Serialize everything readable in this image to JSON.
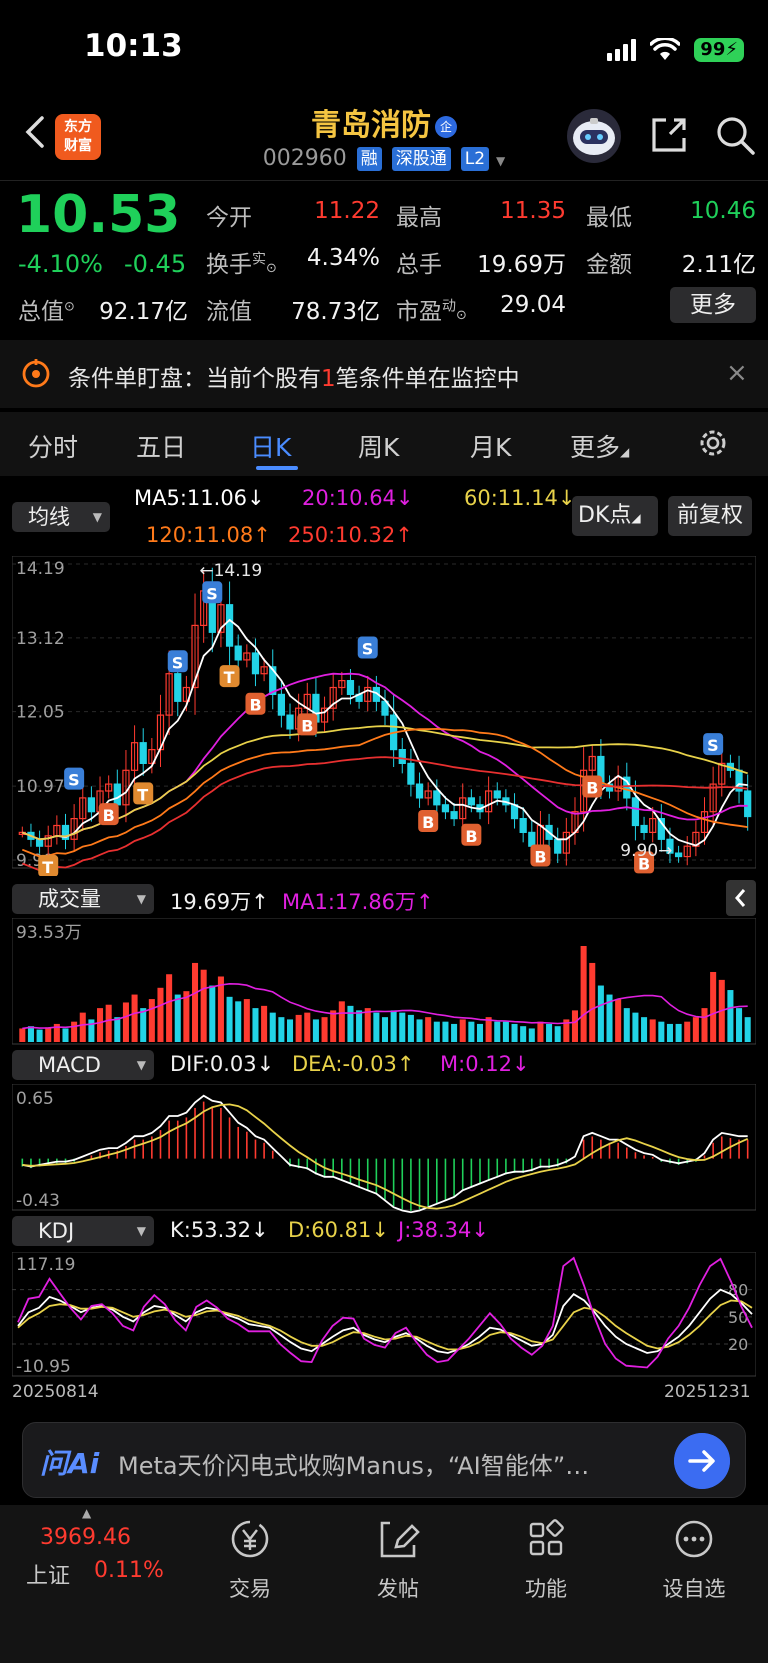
{
  "status_bar": {
    "time": "10:13",
    "battery": "99"
  },
  "header": {
    "logo_line1": "东方",
    "logo_line2": "财富",
    "stock_name": "青岛消防",
    "stock_name_badge": "企",
    "code": "002960",
    "tags": [
      "融",
      "深股通",
      "L2"
    ]
  },
  "quote": {
    "price": "10.53",
    "change_pct": "-4.10%",
    "change_abs": "-0.45",
    "fields": [
      {
        "label": "今开",
        "value": "11.22",
        "color": "#ff3b30"
      },
      {
        "label": "最高",
        "value": "11.35",
        "color": "#ff3b30"
      },
      {
        "label": "最低",
        "value": "10.46",
        "color": "#1fd05a"
      },
      {
        "label": "换手",
        "label_sup": "实",
        "value": "4.34%",
        "color": "#f2f2f2"
      },
      {
        "label": "总手",
        "value": "19.69万",
        "color": "#f2f2f2"
      },
      {
        "label": "金额",
        "value": "2.11亿",
        "color": "#f2f2f2"
      },
      {
        "label": "总值",
        "value": "92.17亿",
        "color": "#f2f2f2"
      },
      {
        "label": "流值",
        "value": "78.73亿",
        "color": "#f2f2f2"
      },
      {
        "label": "市盈",
        "label_sup": "动",
        "value": "29.04",
        "color": "#f2f2f2"
      }
    ],
    "more_label": "更多"
  },
  "notice": {
    "prefix": "条件单盯盘：当前个股有",
    "count": "1",
    "suffix": "笔条件单在监控中",
    "close": "×"
  },
  "tabs": [
    "分时",
    "五日",
    "日K",
    "周K",
    "月K",
    "更多"
  ],
  "active_tab": "日K",
  "indicators": {
    "ma_selector": "均线",
    "ma5": "MA5:11.06↓",
    "ma20": "20:10.64↓",
    "ma60": "60:11.14↓",
    "ma120": "120:11.08↑",
    "ma250": "250:10.32↑",
    "dk_button": "DK点",
    "adjust_button": "前复权",
    "colors": {
      "ma5": "#ffffff",
      "ma20": "#e020e0",
      "ma60": "#e8d24a",
      "ma120": "#ff7a1a",
      "ma250": "#e83030"
    }
  },
  "chart_data": [
    {
      "type": "candlestick",
      "title": "日K",
      "ylim": [
        9.9,
        14.19
      ],
      "y_ticks": [
        "14.19",
        "13.12",
        "12.05",
        "10.97",
        "9.90"
      ],
      "high_label": "←14.19",
      "low_label": "9.90→",
      "signal_labels": [
        "S",
        "B",
        "T"
      ],
      "close_series": [
        10.3,
        10.2,
        10.1,
        10.25,
        10.4,
        10.2,
        10.5,
        10.8,
        10.6,
        10.9,
        11.0,
        10.7,
        11.2,
        11.6,
        11.3,
        11.5,
        12.0,
        12.6,
        12.2,
        12.4,
        13.3,
        13.8,
        13.2,
        13.6,
        13.0,
        12.8,
        12.9,
        12.6,
        12.7,
        12.3,
        12.0,
        11.8,
        12.1,
        12.3,
        11.9,
        12.1,
        12.4,
        12.5,
        12.3,
        12.2,
        12.4,
        12.2,
        12.0,
        11.5,
        11.3,
        11.0,
        10.8,
        10.9,
        10.7,
        10.6,
        10.5,
        10.8,
        10.7,
        10.6,
        10.9,
        10.8,
        10.7,
        10.5,
        10.3,
        10.1,
        10.4,
        10.2,
        10.0,
        10.3,
        10.6,
        11.2,
        11.4,
        11.0,
        10.9,
        11.1,
        10.8,
        10.4,
        10.3,
        10.5,
        10.2,
        10.0,
        9.95,
        10.1,
        10.3,
        10.6,
        11.0,
        11.3,
        11.2,
        10.9,
        10.53
      ]
    },
    {
      "type": "bar",
      "title": "成交量",
      "selector": "成交量",
      "value_label": "19.69万↑",
      "ma_label": "MA1:17.86万↑",
      "y_max_label": "93.53万",
      "values": [
        12,
        14,
        11,
        13,
        16,
        12,
        18,
        26,
        20,
        30,
        33,
        22,
        35,
        42,
        30,
        38,
        48,
        60,
        42,
        45,
        70,
        64,
        50,
        58,
        40,
        36,
        38,
        30,
        32,
        26,
        22,
        20,
        24,
        26,
        20,
        22,
        28,
        36,
        32,
        28,
        30,
        26,
        22,
        28,
        26,
        24,
        20,
        22,
        18,
        18,
        16,
        20,
        18,
        16,
        22,
        18,
        18,
        16,
        14,
        12,
        18,
        16,
        14,
        20,
        28,
        85,
        70,
        50,
        42,
        38,
        30,
        26,
        22,
        20,
        18,
        16,
        16,
        18,
        22,
        30,
        62,
        55,
        46,
        30,
        22
      ]
    },
    {
      "type": "bar",
      "title": "MACD",
      "selector": "MACD",
      "dif_label": "DIF:0.03↓",
      "dea_label": "DEA:-0.03↑",
      "m_label": "M:0.12↓",
      "y_top": "0.65",
      "y_bottom": "-0.43",
      "values": [
        -0.05,
        -0.06,
        -0.05,
        -0.04,
        -0.03,
        -0.03,
        -0.02,
        0.0,
        0.02,
        0.04,
        0.05,
        0.05,
        0.08,
        0.12,
        0.12,
        0.14,
        0.18,
        0.24,
        0.24,
        0.26,
        0.32,
        0.36,
        0.33,
        0.32,
        0.26,
        0.2,
        0.17,
        0.12,
        0.1,
        0.05,
        0.0,
        -0.05,
        -0.06,
        -0.07,
        -0.1,
        -0.12,
        -0.12,
        -0.14,
        -0.16,
        -0.18,
        -0.2,
        -0.22,
        -0.26,
        -0.3,
        -0.32,
        -0.33,
        -0.32,
        -0.3,
        -0.28,
        -0.26,
        -0.24,
        -0.2,
        -0.18,
        -0.16,
        -0.14,
        -0.12,
        -0.1,
        -0.09,
        -0.09,
        -0.08,
        -0.06,
        -0.06,
        -0.05,
        -0.03,
        0.0,
        0.12,
        0.14,
        0.12,
        0.1,
        0.1,
        0.07,
        0.04,
        0.02,
        0.01,
        -0.02,
        -0.03,
        -0.04,
        -0.03,
        -0.02,
        0.02,
        0.1,
        0.14,
        0.13,
        0.12,
        0.12
      ]
    },
    {
      "type": "line",
      "title": "KDJ",
      "selector": "KDJ",
      "k_label": "K:53.32↓",
      "d_label": "D:60.81↓",
      "j_label": "J:38.34↓",
      "y_top": "117.19",
      "y_bottom": "-10.95",
      "ref_levels": [
        "80",
        "50",
        "20"
      ],
      "x_start": "20250814",
      "x_end": "20251231",
      "series": [
        {
          "name": "K",
          "values": [
            40,
            55,
            60,
            72,
            68,
            62,
            55,
            60,
            62,
            58,
            50,
            45,
            55,
            62,
            60,
            52,
            45,
            55,
            60,
            58,
            52,
            48,
            42,
            40,
            38,
            30,
            22,
            15,
            12,
            20,
            28,
            35,
            38,
            30,
            25,
            22,
            28,
            32,
            26,
            18,
            12,
            10,
            14,
            20,
            28,
            38,
            36,
            30,
            24,
            18,
            20,
            30,
            62,
            75,
            68,
            55,
            40,
            28,
            20,
            15,
            10,
            12,
            20,
            28,
            40,
            55,
            70,
            80,
            75,
            65,
            53
          ]
        },
        {
          "name": "D",
          "values": [
            38,
            48,
            54,
            62,
            64,
            63,
            59,
            59,
            61,
            60,
            55,
            50,
            52,
            56,
            58,
            55,
            50,
            52,
            56,
            57,
            54,
            51,
            46,
            43,
            40,
            35,
            28,
            22,
            18,
            18,
            22,
            28,
            33,
            32,
            28,
            25,
            26,
            29,
            28,
            23,
            18,
            14,
            14,
            17,
            22,
            30,
            33,
            32,
            28,
            23,
            21,
            25,
            40,
            55,
            60,
            58,
            50,
            40,
            32,
            25,
            18,
            15,
            17,
            22,
            30,
            40,
            52,
            63,
            68,
            67,
            60
          ]
        },
        {
          "name": "J",
          "values": [
            44,
            70,
            72,
            92,
            76,
            60,
            47,
            62,
            64,
            54,
            40,
            35,
            61,
            74,
            64,
            46,
            35,
            61,
            68,
            60,
            48,
            42,
            34,
            34,
            34,
            20,
            10,
            1,
            0,
            24,
            40,
            49,
            48,
            26,
            19,
            16,
            32,
            38,
            22,
            8,
            0,
            2,
            14,
            26,
            40,
            54,
            42,
            26,
            16,
            8,
            18,
            40,
            106,
            115,
            84,
            49,
            20,
            4,
            -4,
            -5,
            -6,
            6,
            26,
            40,
            60,
            85,
            106,
            114,
            89,
            61,
            38
          ]
        }
      ]
    }
  ],
  "news": {
    "logo": "问Ai",
    "text": "Meta天价闪电式收购Manus，“AI智能体”…"
  },
  "bottom_nav": {
    "index_value": "3969.46",
    "index_name": "上证",
    "index_change": "0.11%",
    "items": [
      "交易",
      "发帖",
      "功能",
      "设自选"
    ]
  }
}
